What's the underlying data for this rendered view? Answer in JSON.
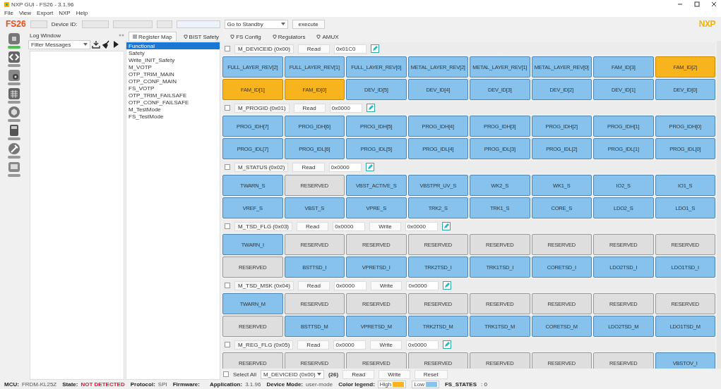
{
  "window": {
    "title": "NXP GUI - FS26 - 3.1.96"
  },
  "menu": [
    "File",
    "View",
    "Export",
    "NXP",
    "Help"
  ],
  "toolbar": {
    "product": "FS26",
    "device_id_label": "Device ID:",
    "mode_select": "Go to Standby",
    "execute_button": "execute",
    "logo": "NXP"
  },
  "side_rail": [
    {
      "kind": "chip",
      "selected": true
    },
    {
      "kind": "code",
      "selected": false
    },
    {
      "kind": "gear",
      "selected": false
    },
    {
      "kind": "grid",
      "selected": false
    },
    {
      "kind": "badge",
      "selected": false
    },
    {
      "kind": "calculator",
      "selected": false
    },
    {
      "kind": "hammer",
      "selected": false
    },
    {
      "kind": "screen",
      "selected": false
    }
  ],
  "log_window": {
    "title": "Log Window",
    "filter": "Filter Messages"
  },
  "tabs": [
    {
      "label": "Register Map",
      "selected": true
    },
    {
      "label": "BIST Safety",
      "selected": false
    },
    {
      "label": "FS Config",
      "selected": false
    },
    {
      "label": "Regulators",
      "selected": false
    },
    {
      "label": "AMUX",
      "selected": false
    }
  ],
  "register_groups": [
    {
      "label": "Functional",
      "selected": true
    },
    {
      "label": "Safety",
      "selected": false
    },
    {
      "label": "Write_INIT_Safety",
      "selected": false
    },
    {
      "label": "M_VOTP",
      "selected": false
    },
    {
      "label": "OTP_TRIM_MAIN",
      "selected": false
    },
    {
      "label": "OTP_CONF_MAIN",
      "selected": false
    },
    {
      "label": "FS_VOTP",
      "selected": false
    },
    {
      "label": "OTP_TRIM_FAILSAFE",
      "selected": false
    },
    {
      "label": "OTP_CONF_FAILSAFE",
      "selected": false
    },
    {
      "label": "M_TestMode",
      "selected": false
    },
    {
      "label": "FS_TestMode",
      "selected": false
    }
  ],
  "registers": [
    {
      "name": "M_DEVICEID (0x00)",
      "checked": false,
      "read_button": "Read",
      "read_value": "0x01C0",
      "bits": [
        {
          "label": "FULL_LAYER_REV[2]",
          "kind": "field",
          "high": false
        },
        {
          "label": "FULL_LAYER_REV[1]",
          "kind": "field",
          "high": false
        },
        {
          "label": "FULL_LAYER_REV[0]",
          "kind": "field",
          "high": false
        },
        {
          "label": "METAL_LAYER_REV[2]",
          "kind": "field",
          "high": false
        },
        {
          "label": "METAL_LAYER_REV[1]",
          "kind": "field",
          "high": false
        },
        {
          "label": "METAL_LAYER_REV[0]",
          "kind": "field",
          "high": false
        },
        {
          "label": "FAM_ID[3]",
          "kind": "field",
          "high": false
        },
        {
          "label": "FAM_ID[2]",
          "kind": "field",
          "high": true
        },
        {
          "label": "FAM_ID[1]",
          "kind": "field",
          "high": true
        },
        {
          "label": "FAM_ID[0]",
          "kind": "field",
          "high": true
        },
        {
          "label": "DEV_ID[5]",
          "kind": "field",
          "high": false
        },
        {
          "label": "DEV_ID[4]",
          "kind": "field",
          "high": false
        },
        {
          "label": "DEV_ID[3]",
          "kind": "field",
          "high": false
        },
        {
          "label": "DEV_ID[2]",
          "kind": "field",
          "high": false
        },
        {
          "label": "DEV_ID[1]",
          "kind": "field",
          "high": false
        },
        {
          "label": "DEV_ID[0]",
          "kind": "field",
          "high": false
        }
      ]
    },
    {
      "name": "M_PROGID (0x01)",
      "checked": false,
      "read_button": "Read",
      "read_value": "0x0000",
      "bits": [
        {
          "label": "PROG_IDH[7]",
          "kind": "field",
          "high": false
        },
        {
          "label": "PROG_IDH[6]",
          "kind": "field",
          "high": false
        },
        {
          "label": "PROG_IDH[5]",
          "kind": "field",
          "high": false
        },
        {
          "label": "PROG_IDH[4]",
          "kind": "field",
          "high": false
        },
        {
          "label": "PROG_IDH[3]",
          "kind": "field",
          "high": false
        },
        {
          "label": "PROG_IDH[2]",
          "kind": "field",
          "high": false
        },
        {
          "label": "PROG_IDH[1]",
          "kind": "field",
          "high": false
        },
        {
          "label": "PROG_IDH[0]",
          "kind": "field",
          "high": false
        },
        {
          "label": "PROG_IDL[7]",
          "kind": "field",
          "high": false
        },
        {
          "label": "PROG_IDL[6]",
          "kind": "field",
          "high": false
        },
        {
          "label": "PROG_IDL[5]",
          "kind": "field",
          "high": false
        },
        {
          "label": "PROG_IDL[4]",
          "kind": "field",
          "high": false
        },
        {
          "label": "PROG_IDL[3]",
          "kind": "field",
          "high": false
        },
        {
          "label": "PROG_IDL[2]",
          "kind": "field",
          "high": false
        },
        {
          "label": "PROG_IDL[1]",
          "kind": "field",
          "high": false
        },
        {
          "label": "PROG_IDL[0]",
          "kind": "field",
          "high": false
        }
      ]
    },
    {
      "name": "M_STATUS (0x02)",
      "checked": false,
      "read_button": "Read",
      "read_value": "0x0000",
      "bits": [
        {
          "label": "TWARN_S",
          "kind": "field",
          "high": false
        },
        {
          "label": "RESERVED",
          "kind": "reserved"
        },
        {
          "label": "VBST_ACTIVE_S",
          "kind": "field",
          "high": false
        },
        {
          "label": "VBSTPR_UV_S",
          "kind": "field",
          "high": false
        },
        {
          "label": "WK2_S",
          "kind": "field",
          "high": false
        },
        {
          "label": "WK1_S",
          "kind": "field",
          "high": false
        },
        {
          "label": "IO2_S",
          "kind": "field",
          "high": false
        },
        {
          "label": "IO1_S",
          "kind": "field",
          "high": false
        },
        {
          "label": "VREF_S",
          "kind": "field",
          "high": false
        },
        {
          "label": "VBST_S",
          "kind": "field",
          "high": false
        },
        {
          "label": "VPRE_S",
          "kind": "field",
          "high": false
        },
        {
          "label": "TRK2_S",
          "kind": "field",
          "high": false
        },
        {
          "label": "TRK1_S",
          "kind": "field",
          "high": false
        },
        {
          "label": "CORE_S",
          "kind": "field",
          "high": false
        },
        {
          "label": "LDO2_S",
          "kind": "field",
          "high": false
        },
        {
          "label": "LDO1_S",
          "kind": "field",
          "high": false
        }
      ]
    },
    {
      "name": "M_TSD_FLG (0x03)",
      "checked": false,
      "read_button": "Read",
      "read_value": "0x0000",
      "write_button": "Write",
      "write_value": "0x0000",
      "bits": [
        {
          "label": "TWARN_I",
          "kind": "field",
          "high": false
        },
        {
          "label": "RESERVED",
          "kind": "reserved"
        },
        {
          "label": "RESERVED",
          "kind": "reserved"
        },
        {
          "label": "RESERVED",
          "kind": "reserved"
        },
        {
          "label": "RESERVED",
          "kind": "reserved"
        },
        {
          "label": "RESERVED",
          "kind": "reserved"
        },
        {
          "label": "RESERVED",
          "kind": "reserved"
        },
        {
          "label": "RESERVED",
          "kind": "reserved"
        },
        {
          "label": "RESERVED",
          "kind": "reserved"
        },
        {
          "label": "BSTTSD_I",
          "kind": "field",
          "high": false
        },
        {
          "label": "VPRETSD_I",
          "kind": "field",
          "high": false
        },
        {
          "label": "TRK2TSD_I",
          "kind": "field",
          "high": false
        },
        {
          "label": "TRK1TSD_I",
          "kind": "field",
          "high": false
        },
        {
          "label": "CORETSD_I",
          "kind": "field",
          "high": false
        },
        {
          "label": "LDO2TSD_I",
          "kind": "field",
          "high": false
        },
        {
          "label": "LDO1TSD_I",
          "kind": "field",
          "high": false
        }
      ]
    },
    {
      "name": "M_TSD_MSK (0x04)",
      "checked": false,
      "read_button": "Read",
      "read_value": "0x0000",
      "write_button": "Write",
      "write_value": "0x0000",
      "bits": [
        {
          "label": "TWARN_M",
          "kind": "field",
          "high": false
        },
        {
          "label": "RESERVED",
          "kind": "reserved"
        },
        {
          "label": "RESERVED",
          "kind": "reserved"
        },
        {
          "label": "RESERVED",
          "kind": "reserved"
        },
        {
          "label": "RESERVED",
          "kind": "reserved"
        },
        {
          "label": "RESERVED",
          "kind": "reserved"
        },
        {
          "label": "RESERVED",
          "kind": "reserved"
        },
        {
          "label": "RESERVED",
          "kind": "reserved"
        },
        {
          "label": "RESERVED",
          "kind": "reserved"
        },
        {
          "label": "BSTTSD_M",
          "kind": "field",
          "high": false
        },
        {
          "label": "VPRETSD_M",
          "kind": "field",
          "high": false
        },
        {
          "label": "TRK2TSD_M",
          "kind": "field",
          "high": false
        },
        {
          "label": "TRK1TSD_M",
          "kind": "field",
          "high": false
        },
        {
          "label": "CORETSD_M",
          "kind": "field",
          "high": false
        },
        {
          "label": "LDO2TSD_M",
          "kind": "field",
          "high": false
        },
        {
          "label": "LDO1TSD_M",
          "kind": "field",
          "high": false
        }
      ]
    },
    {
      "name": "M_REG_FLG (0x05)",
      "checked": false,
      "read_button": "Read",
      "read_value": "0x0000",
      "write_button": "Write",
      "write_value": "0x0000",
      "bits": [
        {
          "label": "RESERVED",
          "kind": "reserved"
        },
        {
          "label": "RESERVED",
          "kind": "reserved"
        },
        {
          "label": "RESERVED",
          "kind": "reserved"
        },
        {
          "label": "RESERVED",
          "kind": "reserved"
        },
        {
          "label": "RESERVED",
          "kind": "reserved"
        },
        {
          "label": "RESERVED",
          "kind": "reserved"
        },
        {
          "label": "RESERVED",
          "kind": "reserved"
        },
        {
          "label": "VBSTOV_I",
          "kind": "field",
          "high": false
        }
      ]
    }
  ],
  "footer": {
    "select_all": "Select All",
    "select_all_checked": false,
    "register_select": "M_DEVICEID (0x00)",
    "count": "(26)",
    "buttons": [
      "Read",
      "Write",
      "Reset"
    ]
  },
  "status_bar": {
    "items": [
      {
        "label": "MCU:",
        "value": "FRDM-KL25Z",
        "kind": "plain"
      },
      {
        "label": "State:",
        "value": "NOT DETECTED",
        "kind": "alert"
      },
      {
        "label": "Protocol:",
        "value": "SPI",
        "kind": "plain"
      },
      {
        "label": "Firmware:",
        "kind": "plain"
      },
      {
        "label": "Application:",
        "value": "3.1.96",
        "kind": "plain"
      },
      {
        "label": "Device Mode:",
        "value": "user-mode",
        "kind": "plain"
      }
    ],
    "legend": {
      "label": "Color legend:",
      "items": [
        {
          "label": "High",
          "color": "#f7b41c"
        },
        {
          "label": "Low",
          "color": "#86c2ec"
        }
      ]
    },
    "fs_states": {
      "label": "FS_STATES",
      "value": ": 0"
    }
  }
}
